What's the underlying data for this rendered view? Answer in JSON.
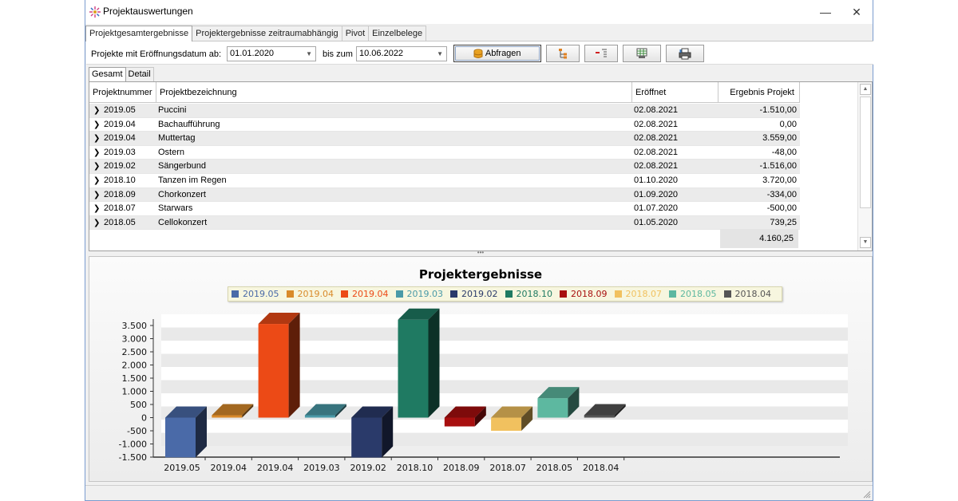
{
  "window": {
    "title": "Projektauswertungen",
    "minimize_glyph": "—",
    "close_glyph": "✕"
  },
  "tabs": [
    {
      "label": "Projektgesamtergebnisse",
      "active": true
    },
    {
      "label": "Projektergebnisse zeitraumabhängig",
      "active": false
    },
    {
      "label": "Pivot",
      "active": false
    },
    {
      "label": "Einzelbelege",
      "active": false
    }
  ],
  "toolbar": {
    "from_label": "Projekte mit Eröffnungsdatum ab:",
    "from_value": "01.01.2020",
    "to_label": "bis zum",
    "to_value": "10.06.2022",
    "query_button": "Abfragen",
    "icons": [
      "database-icon",
      "tree-expand-icon",
      "tree-collapse-icon",
      "export-grid-icon",
      "print-icon"
    ]
  },
  "subtabs": [
    {
      "label": "Gesamt",
      "active": true
    },
    {
      "label": "Detail",
      "active": false
    }
  ],
  "grid": {
    "columns": [
      "Projektnummer",
      "Projektbezeichnung",
      "Eröffnet",
      "Ergebnis Projekt"
    ],
    "rows": [
      {
        "nr": "2019.05",
        "name": "Puccini",
        "date": "02.08.2021",
        "result": "-1.510,00"
      },
      {
        "nr": "2019.04",
        "name": "Bachaufführung",
        "date": "02.08.2021",
        "result": "0,00"
      },
      {
        "nr": "2019.04",
        "name": "Muttertag",
        "date": "02.08.2021",
        "result": "3.559,00"
      },
      {
        "nr": "2019.03",
        "name": "Ostern",
        "date": "02.08.2021",
        "result": "-48,00"
      },
      {
        "nr": "2019.02",
        "name": "Sängerbund",
        "date": "02.08.2021",
        "result": "-1.516,00"
      },
      {
        "nr": "2018.10",
        "name": "Tanzen im Regen",
        "date": "01.10.2020",
        "result": "3.720,00"
      },
      {
        "nr": "2018.09",
        "name": "Chorkonzert",
        "date": "01.09.2020",
        "result": "-334,00"
      },
      {
        "nr": "2018.07",
        "name": "Starwars",
        "date": "01.07.2020",
        "result": "-500,00"
      },
      {
        "nr": "2018.05",
        "name": "Cellokonzert",
        "date": "01.05.2020",
        "result": "739,25"
      }
    ],
    "total": "4.160,25",
    "splitter_glyph": "•••"
  },
  "chart_data": {
    "type": "bar",
    "title": "Projektergebnisse",
    "categories": [
      "2019.05",
      "2019.04",
      "2019.04",
      "2019.03",
      "2019.02",
      "2018.10",
      "2018.09",
      "2018.07",
      "2018.05",
      "2018.04"
    ],
    "values": [
      -1510,
      0,
      3559,
      -48,
      -1516,
      3720,
      -334,
      -500,
      739.25,
      0
    ],
    "colors": [
      "#4a6aa8",
      "#d98a2a",
      "#ec4a16",
      "#4a9aa8",
      "#2a3a6a",
      "#1f7a62",
      "#a80f0f",
      "#f1c15f",
      "#5db8a0",
      "#555555"
    ],
    "legend": [
      "2019.05",
      "2019.04",
      "2019.04",
      "2019.03",
      "2019.02",
      "2018.10",
      "2018.09",
      "2018.07",
      "2018.05",
      "2018.04"
    ],
    "legend_placement": "top-center",
    "ylim": [
      -1500,
      3500
    ],
    "ytick_values": [
      3500,
      3000,
      2500,
      2000,
      1500,
      1000,
      500,
      0,
      -500,
      -1000,
      -1500
    ],
    "ytick_labels": [
      "3.500",
      "3.000",
      "2.500",
      "2.000",
      "1.500",
      "1.000",
      "500",
      "0",
      "-500",
      "-1.000",
      "-1.500"
    ],
    "xlabel": "",
    "ylabel": "",
    "grid": true
  }
}
